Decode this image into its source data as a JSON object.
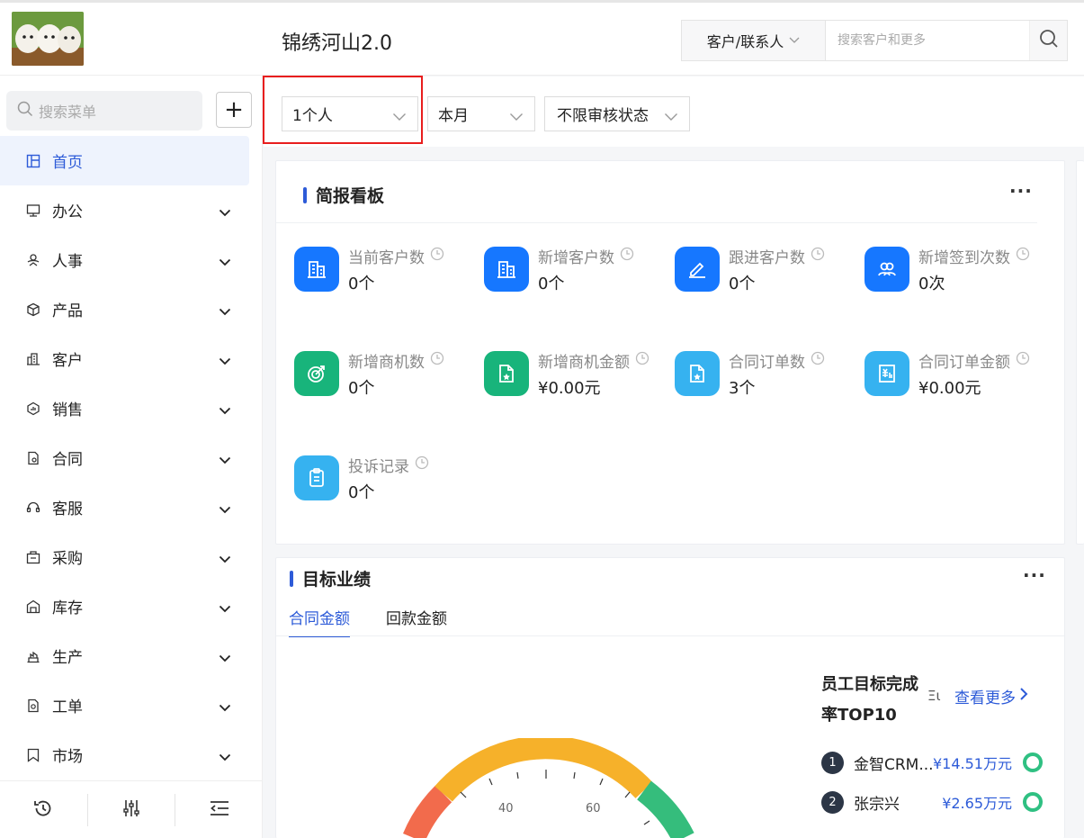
{
  "app": {
    "title": "锦绣河山2.0"
  },
  "search": {
    "type_label": "客户/联系人",
    "placeholder": "搜索客户和更多"
  },
  "sidebar": {
    "search_placeholder": "搜索菜单",
    "add_label": "+",
    "items": [
      {
        "label": "首页",
        "icon": "home-icon",
        "active": true
      },
      {
        "label": "办公",
        "icon": "office-icon"
      },
      {
        "label": "人事",
        "icon": "hr-icon"
      },
      {
        "label": "产品",
        "icon": "product-icon"
      },
      {
        "label": "客户",
        "icon": "customer-icon"
      },
      {
        "label": "销售",
        "icon": "sales-icon"
      },
      {
        "label": "合同",
        "icon": "contract-icon"
      },
      {
        "label": "客服",
        "icon": "service-icon"
      },
      {
        "label": "采购",
        "icon": "purchase-icon"
      },
      {
        "label": "库存",
        "icon": "inventory-icon"
      },
      {
        "label": "生产",
        "icon": "production-icon"
      },
      {
        "label": "工单",
        "icon": "workorder-icon"
      },
      {
        "label": "市场",
        "icon": "market-icon"
      }
    ]
  },
  "filters": {
    "person": "1个人",
    "period": "本月",
    "audit": "不限审核状态"
  },
  "brief": {
    "title": "简报看板",
    "more": "···",
    "metrics": [
      {
        "label": "当前客户数",
        "value": "0个",
        "icon": "building-icon",
        "color": "#1677ff"
      },
      {
        "label": "新增客户数",
        "value": "0个",
        "icon": "building-icon",
        "color": "#1677ff"
      },
      {
        "label": "跟进客户数",
        "value": "0个",
        "icon": "edit-icon",
        "color": "#1677ff"
      },
      {
        "label": "新增签到次数",
        "value": "0次",
        "icon": "users-icon",
        "color": "#1677ff"
      },
      {
        "label": "新增商机数",
        "value": "0个",
        "icon": "target-icon",
        "color": "#18b47b"
      },
      {
        "label": "新增商机金额",
        "value": "¥0.00元",
        "icon": "doc-star-icon",
        "color": "#18b47b"
      },
      {
        "label": "合同订单数",
        "value": "3个",
        "icon": "doc-star-icon",
        "color": "#36b2f0"
      },
      {
        "label": "合同订单金额",
        "value": "¥0.00元",
        "icon": "invoice-icon",
        "color": "#36b2f0"
      },
      {
        "label": "投诉记录",
        "value": "0个",
        "icon": "clipboard-icon",
        "color": "#36b2f0"
      }
    ]
  },
  "target": {
    "title": "目标业绩",
    "more": "···",
    "tabs": [
      "合同金额",
      "回款金额"
    ],
    "gauge_ticks": [
      "40",
      "60"
    ],
    "ranking": {
      "title": "员工目标完成率TOP10",
      "extra": "Ξι",
      "see_more": "查看更多",
      "rows": [
        {
          "no": "1",
          "name": "金智CRM...",
          "amount": "¥14.51万元"
        },
        {
          "no": "2",
          "name": "张宗兴",
          "amount": "¥2.65万元"
        }
      ]
    }
  }
}
